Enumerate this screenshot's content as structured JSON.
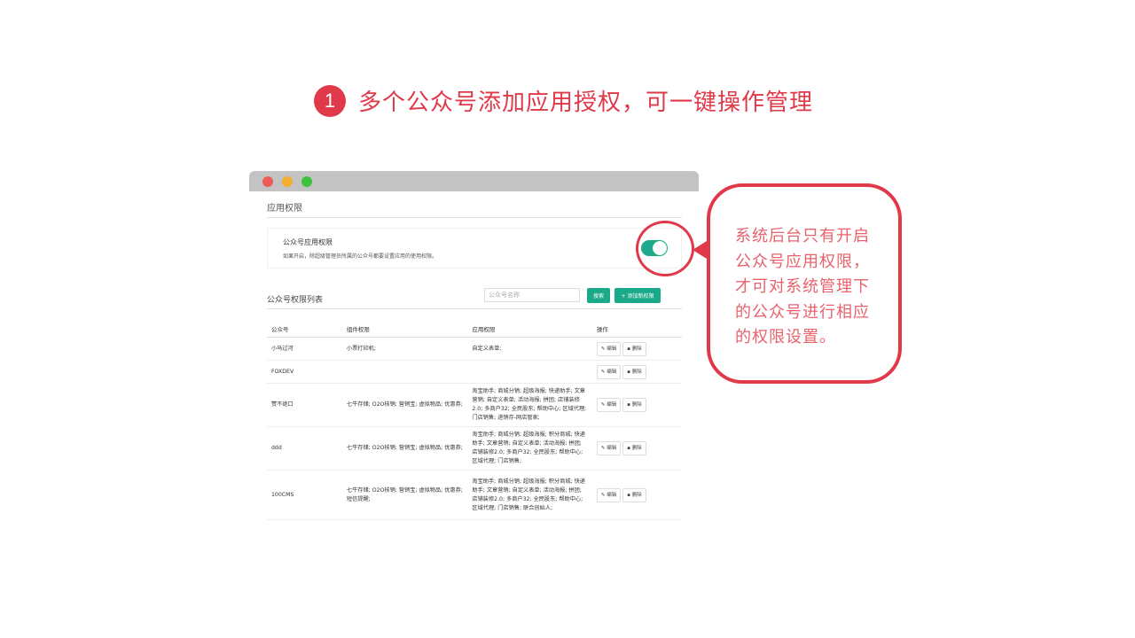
{
  "heading": {
    "step_number": "1",
    "text": "多个公众号添加应用授权，可一键操作管理"
  },
  "window": {
    "section_title": "应用权限",
    "permission": {
      "title": "公众号应用权限",
      "description": "如果开启，除超级管理员所属的公众号都要设置应用的使用权限。",
      "toggle_on": true
    },
    "list": {
      "title": "公众号权限列表",
      "search_placeholder": "公众号名称",
      "search_button": "搜索",
      "add_button": "+ 添加新权限",
      "columns": [
        "公众号",
        "组件权限",
        "应用权限",
        "操作"
      ],
      "edit_label": "编辑",
      "delete_label": "删除",
      "rows": [
        {
          "name": "小马过河",
          "widget": "小票打印机;",
          "app": "自定义表单;"
        },
        {
          "name": "FOXDEV",
          "widget": "",
          "app": ""
        },
        {
          "name": "赞不绝口",
          "widget": "七牛存储; O2O核销; 营销宝; 虚拟物品; 优惠券;",
          "app": "淘宝助手; 商城分销; 超级海报; 快递助手; 文章营销; 自定义表单; 活动海报; 拼团; 店铺装修2.0; 多商户32; 全民股东; 帮助中心; 区域代理; 门店销售; 进销存-网店管家;"
        },
        {
          "name": "ddd",
          "widget": "七牛存储; O2O核销; 营销宝; 虚拟物品; 优惠券;",
          "app": "淘宝助手; 商城分销; 超级海报; 积分商城; 快递助手; 文章营销; 自定义表单; 活动海报; 拼团; 店铺装修2.0; 多商户32; 全民股东; 帮助中心; 区域代理; 门店销售;"
        },
        {
          "name": "100CMS",
          "widget": "七牛存储; O2O核销; 营销宝; 虚拟物品; 优惠券; 短信提醒;",
          "app": "淘宝助手; 商城分销; 超级海报; 积分商城; 快递助手; 文章营销; 自定义表单; 活动海报; 拼团; 店铺装修2.0; 多商户32; 全民股东; 帮助中心; 区域代理; 门店销售; 联合创始人;"
        }
      ]
    }
  },
  "callout": {
    "text": "系统后台只有开启公众号应用权限，才可对系统管理下的公众号进行相应的权限设置。"
  },
  "colors": {
    "accent": "#e0394a",
    "toggle": "#20a98a",
    "button": "#1aaa8a"
  }
}
